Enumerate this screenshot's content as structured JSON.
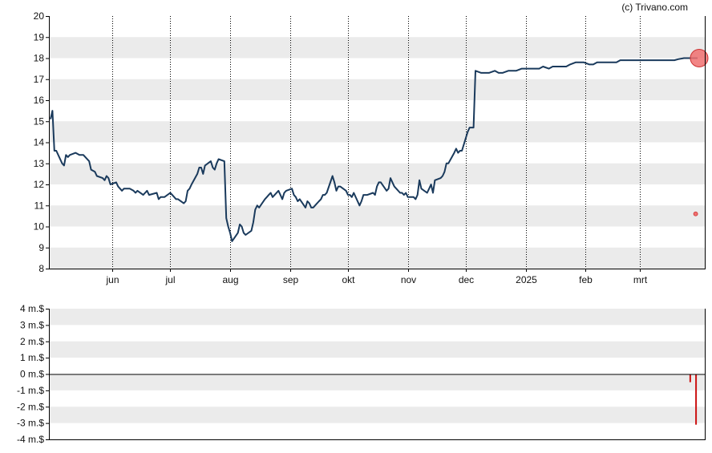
{
  "credit": "(c) Trivano.com",
  "colors": {
    "band": "#ebebeb",
    "line": "#1a3a5c",
    "marker": "#f07070",
    "marker_stroke": "#cc3333",
    "volume_bar": "#cc1111",
    "axis": "#000000"
  },
  "chart_data": [
    {
      "type": "line",
      "title": "",
      "xlabel": "",
      "ylabel": "",
      "ylim": [
        8,
        20
      ],
      "y_ticks": [
        "8",
        "9",
        "10",
        "11",
        "12",
        "13",
        "14",
        "15",
        "16",
        "17",
        "18",
        "19",
        "20"
      ],
      "x_domain": [
        "2024-04-30",
        "2025-03-31"
      ],
      "x_ticks": [
        {
          "label": "jun",
          "date": "2024-06-01"
        },
        {
          "label": "jul",
          "date": "2024-07-01"
        },
        {
          "label": "aug",
          "date": "2024-08-01"
        },
        {
          "label": "sep",
          "date": "2024-09-01"
        },
        {
          "label": "okt",
          "date": "2024-10-01"
        },
        {
          "label": "nov",
          "date": "2024-11-01"
        },
        {
          "label": "dec",
          "date": "2024-12-01"
        },
        {
          "label": "2025",
          "date": "2025-01-01"
        },
        {
          "label": "feb",
          "date": "2025-02-01"
        },
        {
          "label": "mrt",
          "date": "2025-03-01"
        }
      ],
      "grid": "alternating horizontal bands, dotted vertical lines at month ticks",
      "series": [
        {
          "points": [
            [
              "2024-04-30",
              15.1
            ],
            [
              "2024-05-01",
              15.5
            ],
            [
              "2024-05-02",
              13.6
            ],
            [
              "2024-05-03",
              13.6
            ],
            [
              "2024-05-06",
              13.0
            ],
            [
              "2024-05-07",
              12.9
            ],
            [
              "2024-05-08",
              13.4
            ],
            [
              "2024-05-09",
              13.3
            ],
            [
              "2024-05-10",
              13.4
            ],
            [
              "2024-05-13",
              13.5
            ],
            [
              "2024-05-15",
              13.4
            ],
            [
              "2024-05-17",
              13.4
            ],
            [
              "2024-05-20",
              13.1
            ],
            [
              "2024-05-21",
              12.7
            ],
            [
              "2024-05-23",
              12.6
            ],
            [
              "2024-05-24",
              12.4
            ],
            [
              "2024-05-27",
              12.3
            ],
            [
              "2024-05-28",
              12.2
            ],
            [
              "2024-05-29",
              12.4
            ],
            [
              "2024-05-30",
              12.3
            ],
            [
              "2024-05-31",
              12.0
            ],
            [
              "2024-06-03",
              12.1
            ],
            [
              "2024-06-04",
              11.9
            ],
            [
              "2024-06-06",
              11.7
            ],
            [
              "2024-06-07",
              11.8
            ],
            [
              "2024-06-10",
              11.8
            ],
            [
              "2024-06-12",
              11.7
            ],
            [
              "2024-06-13",
              11.6
            ],
            [
              "2024-06-14",
              11.7
            ],
            [
              "2024-06-17",
              11.5
            ],
            [
              "2024-06-18",
              11.6
            ],
            [
              "2024-06-19",
              11.7
            ],
            [
              "2024-06-20",
              11.5
            ],
            [
              "2024-06-24",
              11.6
            ],
            [
              "2024-06-25",
              11.3
            ],
            [
              "2024-06-26",
              11.4
            ],
            [
              "2024-06-28",
              11.4
            ],
            [
              "2024-07-01",
              11.6
            ],
            [
              "2024-07-02",
              11.5
            ],
            [
              "2024-07-04",
              11.3
            ],
            [
              "2024-07-05",
              11.3
            ],
            [
              "2024-07-08",
              11.1
            ],
            [
              "2024-07-09",
              11.2
            ],
            [
              "2024-07-10",
              11.7
            ],
            [
              "2024-07-11",
              11.8
            ],
            [
              "2024-07-12",
              12.0
            ],
            [
              "2024-07-15",
              12.5
            ],
            [
              "2024-07-16",
              12.8
            ],
            [
              "2024-07-17",
              12.8
            ],
            [
              "2024-07-18",
              12.5
            ],
            [
              "2024-07-19",
              12.9
            ],
            [
              "2024-07-22",
              13.1
            ],
            [
              "2024-07-23",
              12.8
            ],
            [
              "2024-07-24",
              12.7
            ],
            [
              "2024-07-25",
              13.0
            ],
            [
              "2024-07-26",
              13.2
            ],
            [
              "2024-07-29",
              13.1
            ],
            [
              "2024-07-30",
              10.4
            ],
            [
              "2024-07-31",
              10.0
            ],
            [
              "2024-08-01",
              9.7
            ],
            [
              "2024-08-02",
              9.3
            ],
            [
              "2024-08-05",
              9.7
            ],
            [
              "2024-08-06",
              10.1
            ],
            [
              "2024-08-07",
              10.0
            ],
            [
              "2024-08-08",
              9.7
            ],
            [
              "2024-08-09",
              9.6
            ],
            [
              "2024-08-12",
              9.8
            ],
            [
              "2024-08-13",
              10.2
            ],
            [
              "2024-08-14",
              10.8
            ],
            [
              "2024-08-15",
              11.0
            ],
            [
              "2024-08-16",
              10.9
            ],
            [
              "2024-08-19",
              11.3
            ],
            [
              "2024-08-20",
              11.4
            ],
            [
              "2024-08-21",
              11.5
            ],
            [
              "2024-08-22",
              11.6
            ],
            [
              "2024-08-23",
              11.4
            ],
            [
              "2024-08-26",
              11.7
            ],
            [
              "2024-08-27",
              11.5
            ],
            [
              "2024-08-28",
              11.3
            ],
            [
              "2024-08-29",
              11.6
            ],
            [
              "2024-08-30",
              11.7
            ],
            [
              "2024-09-02",
              11.8
            ],
            [
              "2024-09-03",
              11.5
            ],
            [
              "2024-09-04",
              11.4
            ],
            [
              "2024-09-05",
              11.2
            ],
            [
              "2024-09-06",
              11.3
            ],
            [
              "2024-09-09",
              10.9
            ],
            [
              "2024-09-10",
              11.2
            ],
            [
              "2024-09-11",
              11.1
            ],
            [
              "2024-09-12",
              10.9
            ],
            [
              "2024-09-13",
              10.9
            ],
            [
              "2024-09-16",
              11.2
            ],
            [
              "2024-09-17",
              11.3
            ],
            [
              "2024-09-18",
              11.5
            ],
            [
              "2024-09-19",
              11.5
            ],
            [
              "2024-09-20",
              11.6
            ],
            [
              "2024-09-23",
              12.4
            ],
            [
              "2024-09-24",
              12.1
            ],
            [
              "2024-09-25",
              11.7
            ],
            [
              "2024-09-26",
              11.9
            ],
            [
              "2024-09-27",
              11.9
            ],
            [
              "2024-09-30",
              11.7
            ],
            [
              "2024-10-01",
              11.5
            ],
            [
              "2024-10-02",
              11.5
            ],
            [
              "2024-10-03",
              11.4
            ],
            [
              "2024-10-04",
              11.6
            ],
            [
              "2024-10-07",
              11.0
            ],
            [
              "2024-10-08",
              11.2
            ],
            [
              "2024-10-09",
              11.5
            ],
            [
              "2024-10-10",
              11.5
            ],
            [
              "2024-10-11",
              11.5
            ],
            [
              "2024-10-14",
              11.6
            ],
            [
              "2024-10-15",
              11.5
            ],
            [
              "2024-10-16",
              11.9
            ],
            [
              "2024-10-17",
              12.1
            ],
            [
              "2024-10-18",
              12.1
            ],
            [
              "2024-10-21",
              11.7
            ],
            [
              "2024-10-22",
              11.8
            ],
            [
              "2024-10-23",
              12.3
            ],
            [
              "2024-10-24",
              12.1
            ],
            [
              "2024-10-25",
              11.9
            ],
            [
              "2024-10-28",
              11.6
            ],
            [
              "2024-10-29",
              11.6
            ],
            [
              "2024-10-30",
              11.5
            ],
            [
              "2024-10-31",
              11.6
            ],
            [
              "2024-11-01",
              11.4
            ],
            [
              "2024-11-04",
              11.4
            ],
            [
              "2024-11-05",
              11.3
            ],
            [
              "2024-11-06",
              11.5
            ],
            [
              "2024-11-07",
              12.2
            ],
            [
              "2024-11-08",
              11.8
            ],
            [
              "2024-11-11",
              11.6
            ],
            [
              "2024-11-12",
              11.8
            ],
            [
              "2024-11-13",
              12.0
            ],
            [
              "2024-11-14",
              11.6
            ],
            [
              "2024-11-15",
              12.2
            ],
            [
              "2024-11-18",
              12.3
            ],
            [
              "2024-11-19",
              12.4
            ],
            [
              "2024-11-20",
              12.6
            ],
            [
              "2024-11-21",
              13.0
            ],
            [
              "2024-11-22",
              13.0
            ],
            [
              "2024-11-25",
              13.5
            ],
            [
              "2024-11-26",
              13.7
            ],
            [
              "2024-11-27",
              13.5
            ],
            [
              "2024-11-28",
              13.6
            ],
            [
              "2024-11-29",
              13.6
            ],
            [
              "2024-12-02",
              14.5
            ],
            [
              "2024-12-03",
              14.7
            ],
            [
              "2024-12-04",
              14.7
            ],
            [
              "2024-12-05",
              14.7
            ],
            [
              "2024-12-06",
              17.4
            ],
            [
              "2024-12-09",
              17.3
            ],
            [
              "2024-12-11",
              17.3
            ],
            [
              "2024-12-13",
              17.3
            ],
            [
              "2024-12-16",
              17.4
            ],
            [
              "2024-12-18",
              17.3
            ],
            [
              "2024-12-20",
              17.3
            ],
            [
              "2024-12-23",
              17.4
            ],
            [
              "2024-12-27",
              17.4
            ],
            [
              "2024-12-30",
              17.5
            ],
            [
              "2025-01-02",
              17.5
            ],
            [
              "2025-01-06",
              17.5
            ],
            [
              "2025-01-08",
              17.5
            ],
            [
              "2025-01-10",
              17.6
            ],
            [
              "2025-01-13",
              17.5
            ],
            [
              "2025-01-15",
              17.6
            ],
            [
              "2025-01-17",
              17.6
            ],
            [
              "2025-01-20",
              17.6
            ],
            [
              "2025-01-22",
              17.6
            ],
            [
              "2025-01-24",
              17.7
            ],
            [
              "2025-01-27",
              17.8
            ],
            [
              "2025-01-29",
              17.8
            ],
            [
              "2025-01-31",
              17.8
            ],
            [
              "2025-02-03",
              17.7
            ],
            [
              "2025-02-05",
              17.7
            ],
            [
              "2025-02-07",
              17.8
            ],
            [
              "2025-02-10",
              17.8
            ],
            [
              "2025-02-12",
              17.8
            ],
            [
              "2025-02-14",
              17.8
            ],
            [
              "2025-02-17",
              17.8
            ],
            [
              "2025-02-19",
              17.9
            ],
            [
              "2025-02-21",
              17.9
            ],
            [
              "2025-02-24",
              17.9
            ],
            [
              "2025-02-26",
              17.9
            ],
            [
              "2025-02-28",
              17.9
            ],
            [
              "2025-03-03",
              17.9
            ],
            [
              "2025-03-05",
              17.9
            ],
            [
              "2025-03-07",
              17.9
            ],
            [
              "2025-03-10",
              17.9
            ],
            [
              "2025-03-12",
              17.9
            ],
            [
              "2025-03-14",
              17.9
            ],
            [
              "2025-03-17",
              17.9
            ],
            [
              "2025-03-19",
              17.9
            ],
            [
              "2025-03-21",
              17.95
            ],
            [
              "2025-03-24",
              18.0
            ],
            [
              "2025-03-26",
              18.0
            ],
            [
              "2025-03-28",
              18.0
            ],
            [
              "2025-03-31",
              18.0
            ]
          ]
        }
      ],
      "last_point_marker": {
        "date": "2025-03-31",
        "value": 18.0
      },
      "small_marker": {
        "date": "2025-03-30",
        "value": 10.6
      }
    },
    {
      "type": "bar",
      "title": "",
      "xlabel": "",
      "ylabel": "",
      "ylim": [
        -4,
        4
      ],
      "y_ticks": [
        "4 m.$",
        "3 m.$",
        "2 m.$",
        "1 m.$",
        "0 m.$",
        "-1 m.$",
        "-2 m.$",
        "-3 m.$",
        "-4 m.$"
      ],
      "y_tick_values": [
        4,
        3,
        2,
        1,
        0,
        -1,
        -2,
        -3,
        -4
      ],
      "grid": "alternating horizontal bands",
      "bars": [
        {
          "date": "2025-03-27",
          "value": -0.5
        },
        {
          "date": "2025-03-30",
          "value": -3.1
        }
      ]
    }
  ]
}
